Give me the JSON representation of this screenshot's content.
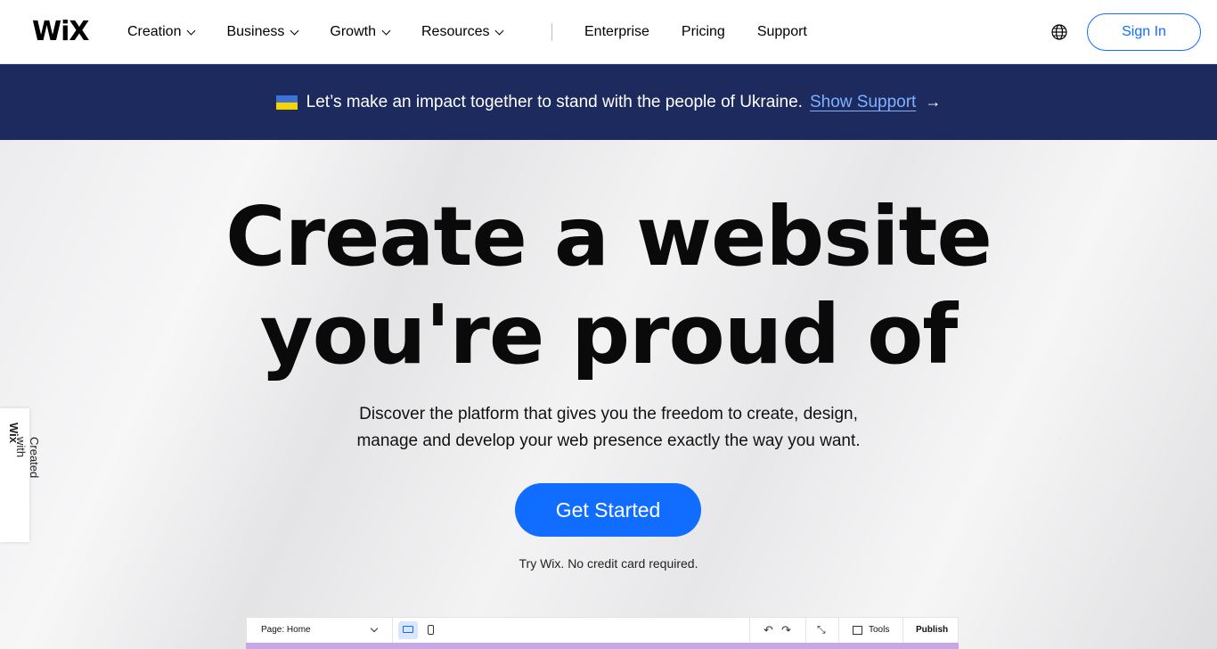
{
  "header": {
    "logo": "WiX",
    "nav": [
      "Creation",
      "Business",
      "Growth",
      "Resources"
    ],
    "nav_plain": [
      "Enterprise",
      "Pricing",
      "Support"
    ],
    "sign_in": "Sign In"
  },
  "banner": {
    "text": "Let’s make an impact together to stand with the people of Ukraine.",
    "link": "Show Support",
    "arrow": "→"
  },
  "hero": {
    "headline_line1": "Create a website",
    "headline_line2": "you're proud of",
    "sub_line1": "Discover the platform that gives you the freedom to create, design,",
    "sub_line2": "manage and develop your web presence exactly the way you want.",
    "cta": "Get Started",
    "note": "Try Wix. No credit card required."
  },
  "badge": {
    "prefix": "Created with ",
    "brand": "Wix"
  },
  "editor": {
    "page": "Page: Home",
    "tools": "Tools",
    "publish": "Publish"
  },
  "colors": {
    "accent": "#116dff",
    "banner": "#1c2a5e",
    "link": "#7fb1ff"
  }
}
